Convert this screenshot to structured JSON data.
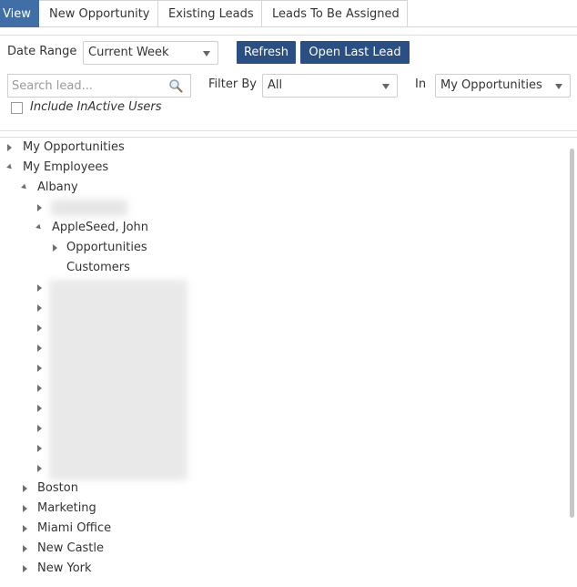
{
  "tabs": [
    {
      "label": "View",
      "active": true
    },
    {
      "label": "New Opportunity"
    },
    {
      "label": "Existing Leads"
    },
    {
      "label": "Leads To Be Assigned"
    }
  ],
  "filters": {
    "date_range_label": "Date Range",
    "date_range_value": "Current Week",
    "refresh_label": "Refresh",
    "open_last_lead_label": "Open Last Lead",
    "search_placeholder": "Search lead...",
    "filter_by_label": "Filter By",
    "filter_by_value": "All",
    "in_label": "In",
    "in_value": "My Opportunities",
    "include_inactive_label": "Include InActive Users"
  },
  "tree": {
    "my_opportunities": "My Opportunities",
    "my_employees": "My Employees",
    "albany": "Albany",
    "appleseed": "AppleSeed, John",
    "opportunities": "Opportunities",
    "customers": "Customers",
    "boston": "Boston",
    "marketing": "Marketing",
    "miami": "Miami Office",
    "new_castle": "New Castle",
    "new_york": "New York"
  },
  "colors": {
    "active_tab": "#3f6fa6",
    "button": "#2a4f82"
  }
}
